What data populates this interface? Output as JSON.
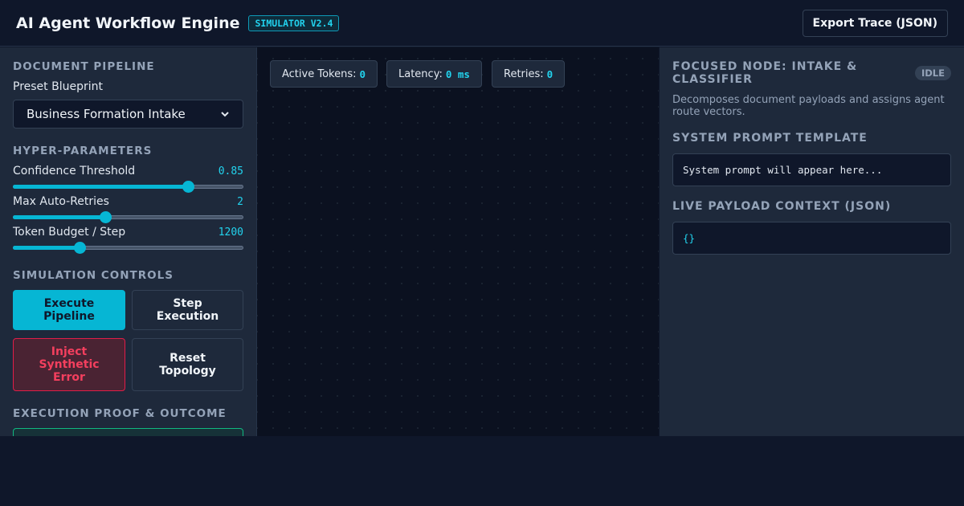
{
  "header": {
    "title": "AI Agent Workflow Engine",
    "version_badge": "SIMULATOR V2.4",
    "export_label": "Export Trace (JSON)"
  },
  "left_panel": {
    "pipeline_section": "DOCUMENT PIPELINE",
    "preset_label": "Preset Blueprint",
    "preset_selected": "Business Formation Intake",
    "hyper_section": "HYPER-PARAMETERS",
    "sliders": [
      {
        "label": "Confidence Threshold",
        "value": "0.85",
        "fraction": 0.76
      },
      {
        "label": "Max Auto-Retries",
        "value": "2",
        "fraction": 0.4
      },
      {
        "label": "Token Budget / Step",
        "value": "1200",
        "fraction": 0.29
      }
    ],
    "controls_section": "SIMULATION CONTROLS",
    "buttons": {
      "execute": "Execute Pipeline",
      "step": "Step Execution",
      "inject": "Inject Synthetic Error",
      "reset": "Reset Topology"
    },
    "outcome_section": "EXECUTION PROOF & OUTCOME"
  },
  "canvas": {
    "metrics": [
      {
        "label": "Active Tokens:",
        "value": "0"
      },
      {
        "label": "Latency:",
        "value": "0 ms"
      },
      {
        "label": "Retries:",
        "value": "0"
      }
    ]
  },
  "right_panel": {
    "node_title": "FOCUSED NODE: INTAKE & CLASSIFIER",
    "status_badge": "IDLE",
    "description": "Decomposes document payloads and assigns agent route vectors.",
    "prompt_section": "SYSTEM PROMPT TEMPLATE",
    "prompt_text": "System prompt will appear here...",
    "payload_section": "LIVE PAYLOAD CONTEXT (JSON)",
    "payload_text": "{}"
  },
  "colors": {
    "accent": "#06b6d4",
    "danger": "#f43f5e",
    "success": "#10b981",
    "background": "#0f172a",
    "panel": "#1e293b"
  }
}
